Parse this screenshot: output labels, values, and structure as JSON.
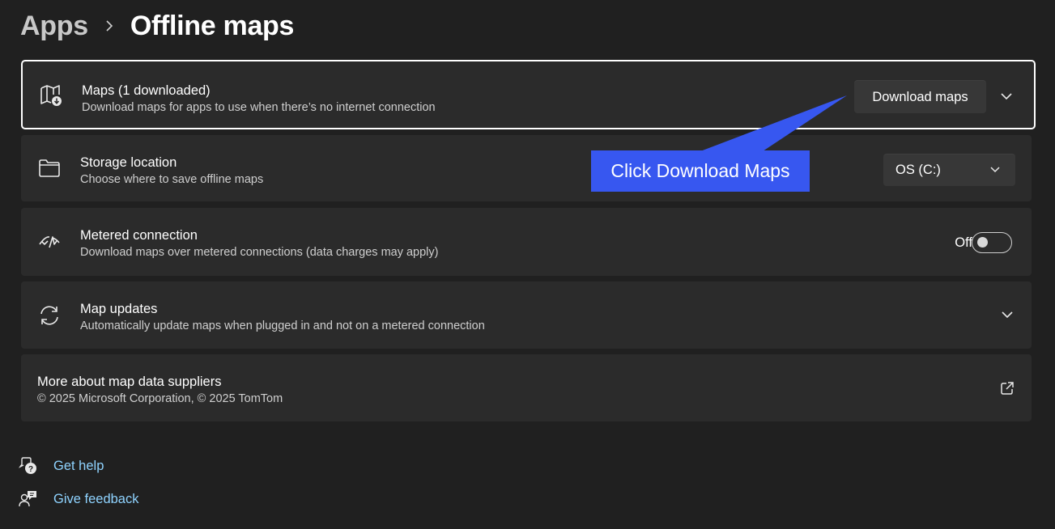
{
  "breadcrumb": {
    "parent": "Apps",
    "current": "Offline maps"
  },
  "maps_card": {
    "icon": "map-download-icon",
    "title": "Maps (1 downloaded)",
    "description": "Download maps for apps to use when there’s no internet connection",
    "button_label": "Download maps"
  },
  "storage_card": {
    "icon": "folder-icon",
    "title": "Storage location",
    "description": "Choose where to save offline maps",
    "selected": "OS (C:)"
  },
  "metered_card": {
    "icon": "metered-connection-icon",
    "title": "Metered connection",
    "description": "Download maps over metered connections (data charges may apply)",
    "toggle_label": "Off",
    "toggle_on": false
  },
  "updates_card": {
    "icon": "sync-icon",
    "title": "Map updates",
    "description": "Automatically update maps when plugged in and not on a metered connection"
  },
  "suppliers_card": {
    "title": "More about map data suppliers",
    "description": "© 2025 Microsoft Corporation, © 2025 TomTom",
    "icon": "external-link-icon"
  },
  "callout": {
    "text": "Click Download Maps",
    "color": "#3757f0"
  },
  "help_links": {
    "get_help": "Get help",
    "give_feedback": "Give feedback"
  },
  "colors": {
    "background": "#202020",
    "card": "#2b2b2b",
    "link": "#8fd3ff"
  }
}
